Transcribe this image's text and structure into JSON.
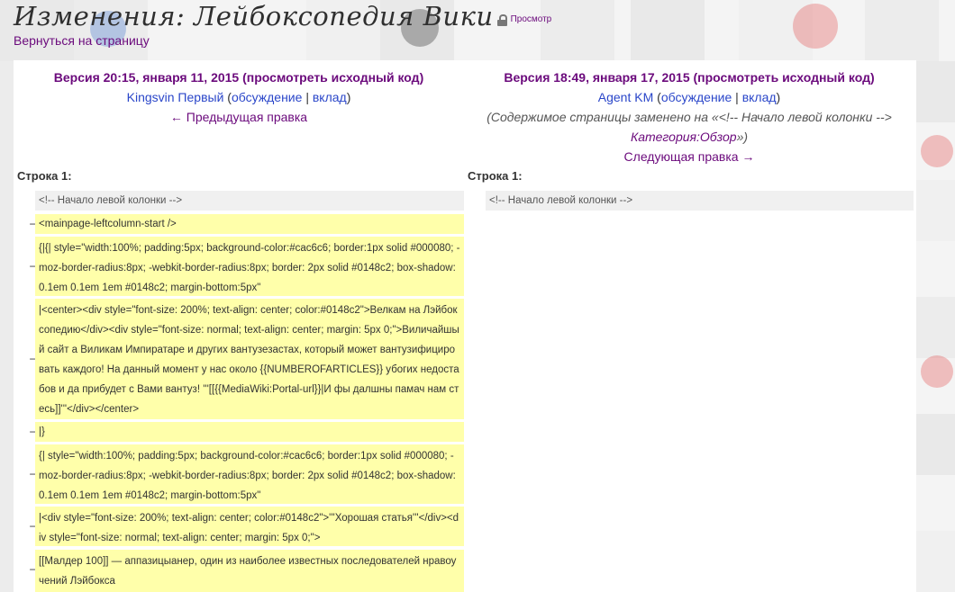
{
  "page": {
    "title": "Изменения: Лейбоксопедия Вики",
    "view_link": "Просмотр",
    "back_link": "Вернуться на страницу"
  },
  "left_revision": {
    "version_label": "Версия 20:15, января 11, 2015",
    "view_source": "просмотреть исходный код",
    "author": "Kingsvin Первый",
    "talk": "обсуждение",
    "contribs": "вклад",
    "prev_edit": "← Предыдущая правка",
    "line_label": "Строка 1:"
  },
  "right_revision": {
    "version_label": "Версия 18:49, января 17, 2015",
    "view_source": "просмотреть исходный код",
    "author": "Agent KM",
    "talk": "обсуждение",
    "contribs": "вклад",
    "summary_text": "(Содержимое страницы заменено на «<!-- Начало левой колонки -->",
    "summary_link": "Категория:Обзор",
    "summary_end": "»)",
    "next_edit": "Следующая правка →",
    "line_label": "Строка 1:"
  },
  "diff": {
    "context_line": "<!-- Начало левой колонки -->",
    "minus_sign": "−",
    "deleted_lines": [
      "<mainpage-leftcolumn-start />",
      "{|{| style=\"width:100%; padding:5px; background-color:#cac6c6; border:1px solid #000080; -moz-border-radius:8px; -webkit-border-radius:8px; border: 2px solid #0148c2; box-shadow:0.1em 0.1em 1em #0148c2; margin-bottom:5px\"",
      "|<center><div style=\"font-size: 200%; text-align: center; color:#0148c2\">Велкам на Лэйбоксопедию</div><div style=\"font-size: normal; text-align: center; margin: 5px 0;\">Виличайшый сайт а Виликам Импиратаре и других вантузезастах, который может вантузифицировать каждого! На данный момент у нас около {{NUMBEROFARTICLES}} убогих недостабов и да прибудет с Вами вантуз! '''[[{{MediaWiki:Portal-url}}|И фы далшны памач нам стесь]]'''</div></center>",
      "|}",
      "{| style=\"width:100%; padding:5px; background-color:#cac6c6; border:1px solid #000080; -moz-border-radius:8px; -webkit-border-radius:8px; border: 2px solid #0148c2; box-shadow:0.1em 0.1em 1em #0148c2; margin-bottom:5px\"",
      "|<div style=\"font-size: 200%; text-align: center; color:#0148c2\">'''Хорошая статья'''</div><div style=\"font-size: normal; text-align: center; margin: 5px 0;\">",
      "[[Малдер 100]] — аппазицыанер, один из наиболее известных последователей нравоучений Лэйбокса"
    ]
  },
  "colors": {
    "link_purple": "#6b0a7c",
    "link_blue": "#2a46c9",
    "deleted_bg": "#ffffaa",
    "context_bg": "#f0f0f0"
  }
}
